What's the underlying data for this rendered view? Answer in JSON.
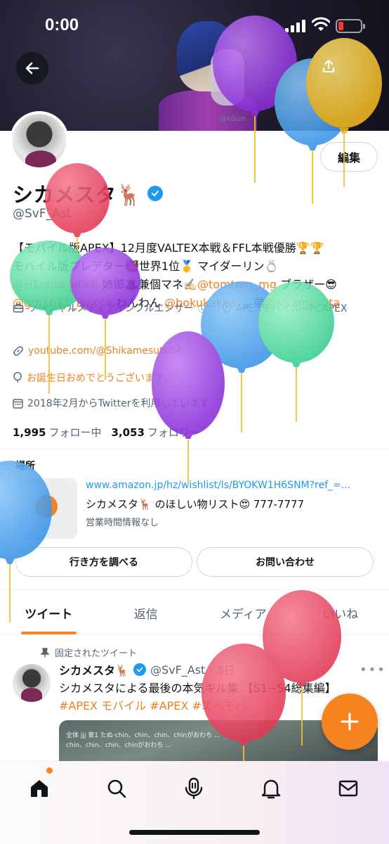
{
  "status_bar": {
    "time": "0:00"
  },
  "banner": {
    "watermark": "@koun"
  },
  "profile": {
    "edit_label": "編集",
    "display_name": "シカメスタ🦌",
    "handle": "@SvF_Ast",
    "bio_line1": "【モバイル版APEX】12月度VALTEX本戦＆FFL本戦優勝🏆🏆",
    "bio_line2": "モバイル版プレデター👹世界1位🥇 マイダーリン💍",
    "bio_mention_1": "@H1nqta_a0k6",
    "bio_line3_text": " 姉御🎩兼個マネ✍🏻",
    "bio_mention_2": "@tomtom_mg",
    "bio_line3_end": " ブラザー😎",
    "bio_mention_3": "@gm1671",
    "bio_mention_4": "_BvX6e",
    "bio_line4_text": " わんわん ",
    "bio_mention_5": "@bokukakka",
    "bio_line4_mid": " 🍃弟",
    "bio_mention_6": "@sikamesuta",
    "category": "ソーシャルメディアインフルエンサー",
    "location": "APEXモバイル→PCAPEX",
    "url": "youtube.com/@Shikamesuta04...",
    "birthday": "お誕生日おめでとうございます。",
    "joined": "2018年2月からTwitterを利用しています",
    "following_count": "1,995",
    "following_label": "フォロー中",
    "followers_count": "3,053",
    "followers_label": "フォロワー"
  },
  "shop": {
    "section_label": "場所",
    "url": "www.amazon.jp/hz/wishlist/ls/BYOKW1H6SNM?ref_=...",
    "name": "シカメスタ🦌 のほしい物リスト😍  777-7777",
    "hours": "営業時間情報なし",
    "directions_label": "行き方を調べる",
    "contact_label": "お問い合わせ"
  },
  "tabs": [
    {
      "label": "ツイート",
      "active": true
    },
    {
      "label": "返信"
    },
    {
      "label": "メディア"
    },
    {
      "label": "いいね"
    }
  ],
  "pinned_tweet": {
    "pinned_label": "固定されたツイート",
    "name": "シカメスタ🦌",
    "handle": "@SvF_Ast",
    "time": "· 3日",
    "more": "•••",
    "text": "シカメスタによる最後の本気キル集 【S1~S4総集編】",
    "tag_1": "#APEX モバイル",
    "tag_2": "#APEX",
    "tag_3": "#エペモバ",
    "media_line_1": "全体 jjj 第1 たぬ·chin、chin、chin、chinがおわち ...",
    "media_line_2": "chin、chin、chin、chinがおわち ..."
  },
  "fab": {
    "label": "+"
  },
  "bottom_nav": [
    "home-icon",
    "search-icon",
    "spaces-icon",
    "bell-icon",
    "mail-icon"
  ],
  "colors": {
    "accent": "#f58420",
    "link": "#f0801e",
    "blue_link": "#1d9bf0",
    "verified": "#1d9bf0",
    "balloon_red": "#e9445f",
    "balloon_purple": "#9b3ee0",
    "balloon_blue": "#4aa3ee",
    "balloon_green": "#4ed9a0",
    "balloon_yellow": "#f2c12e"
  }
}
